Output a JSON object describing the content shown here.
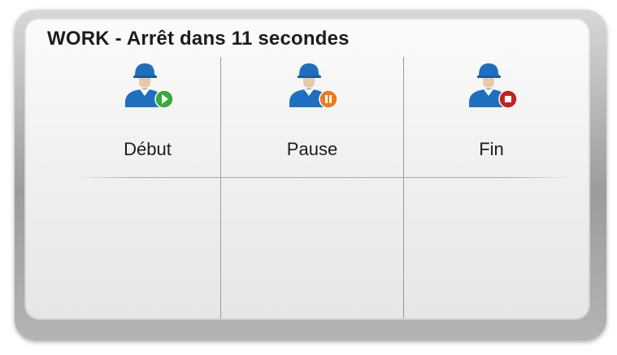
{
  "screen": {
    "title": "WORK - Arrêt dans 11 secondes"
  },
  "actions": [
    {
      "label": "Début",
      "icon": "worker-play-icon",
      "badge_color": "#3aa83a"
    },
    {
      "label": "Pause",
      "icon": "worker-pause-icon",
      "badge_color": "#f07a1a"
    },
    {
      "label": "Fin",
      "icon": "worker-stop-icon",
      "badge_color": "#c8201e"
    }
  ],
  "colors": {
    "worker_blue": "#1f6fc0",
    "skin": "#e8c9a8"
  }
}
